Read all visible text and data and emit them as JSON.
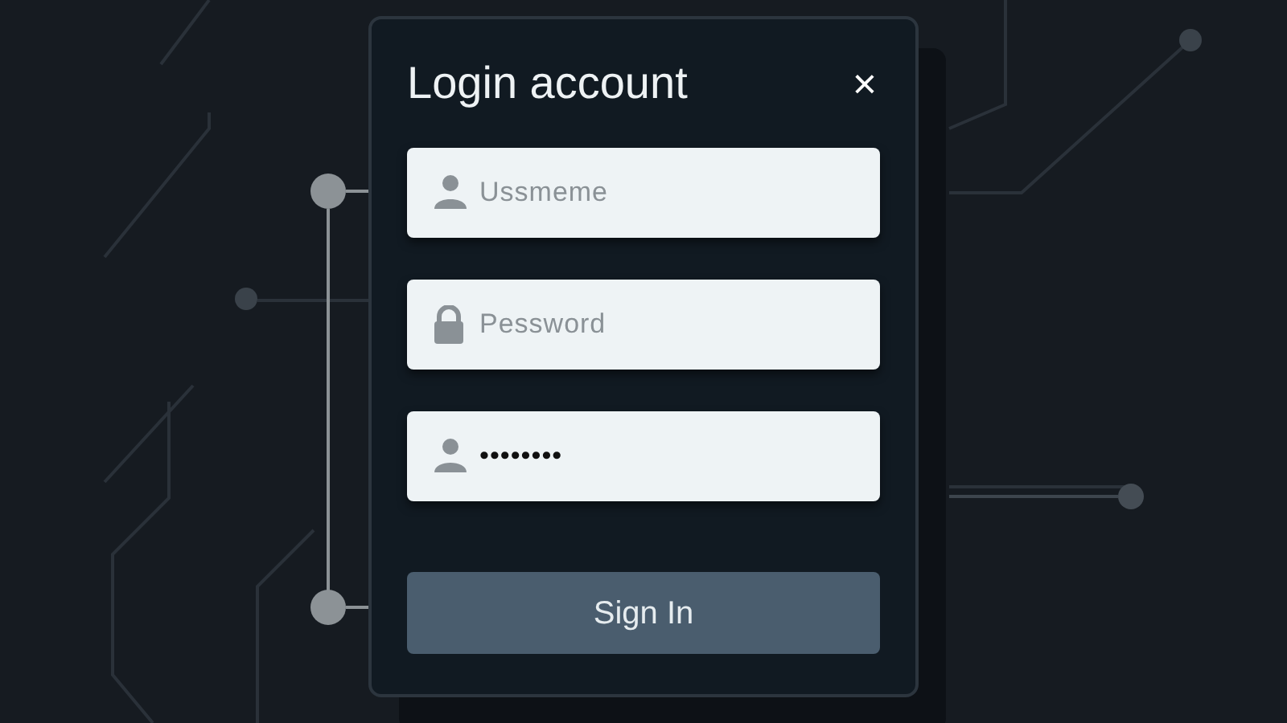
{
  "dialog": {
    "title": "Login account",
    "close": "×",
    "fields": [
      {
        "kind": "person",
        "placeholder": "Ussmeme"
      },
      {
        "kind": "lock",
        "placeholder": "Pessword"
      },
      {
        "kind": "person",
        "value": "••••••••"
      }
    ],
    "submit": "Sign In"
  }
}
